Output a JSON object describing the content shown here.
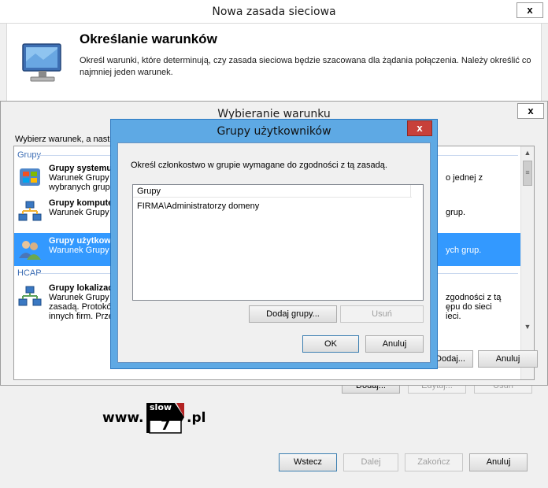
{
  "main_window": {
    "title": "Nowa zasada sieciowa",
    "close_label": "x",
    "header_title": "Określanie warunków",
    "header_desc": "Określ warunki, które determinują, czy zasada sieciowa będzie szacowana dla żądania połączenia. Należy określić co najmniej jeden warunek.",
    "footer_buttons": {
      "back": "Wstecz",
      "next": "Dalej",
      "finish": "Zakończ",
      "cancel": "Anuluj"
    },
    "behind_buttons": {
      "add": "Dodaj...",
      "edit": "Edytuj...",
      "remove": "Usuń"
    }
  },
  "logo": {
    "www": "www.",
    "slow": "slow",
    "seven": "7",
    "pl": ".pl"
  },
  "condition_dialog": {
    "title": "Wybieranie warunku",
    "close_label": "x",
    "prompt": "Wybierz warunek, a nastę",
    "groups": [
      {
        "header": "Grupy",
        "items": [
          {
            "name": "Grupy systemu",
            "desc1": "Warunek Grupy",
            "desc2": "wybranych grup",
            "tail1": "o jednej z",
            "tail2": "",
            "icon": "windows-group-icon",
            "selected": false
          },
          {
            "name": "Grupy kompute",
            "desc1": "Warunek Grupy",
            "desc2": "",
            "tail1": "grup.",
            "tail2": "",
            "icon": "computer-group-icon",
            "selected": false
          },
          {
            "name": "Grupy użytkow",
            "desc1": "Warunek Grupy",
            "desc2": "",
            "tail1": "ych grup.",
            "tail2": "",
            "icon": "user-group-icon",
            "selected": true
          }
        ]
      },
      {
        "header": "HCAP",
        "items": [
          {
            "name": "Grupy lokalizac",
            "desc1": "Warunek Grupy",
            "desc2": "zasadą. Protokó",
            "desc3": "innych firm. Prze",
            "tail1": "zgodności z tą",
            "tail2": "ępu do sieci",
            "tail3": "ieci.",
            "icon": "location-group-icon",
            "selected": false
          }
        ]
      }
    ],
    "add_button": "Dodaj...",
    "cancel_button": "Anuluj"
  },
  "user_groups_dialog": {
    "title": "Grupy użytkowników",
    "close_label": "x",
    "prompt": "Określ członkostwo w grupie wymagane do zgodności z tą zasadą.",
    "column_header": "Grupy",
    "rows": [
      "FIRMA\\Administratorzy domeny"
    ],
    "add_groups_button": "Dodaj grupy...",
    "remove_button": "Usuń",
    "ok_button": "OK",
    "cancel_button": "Anuluj"
  }
}
